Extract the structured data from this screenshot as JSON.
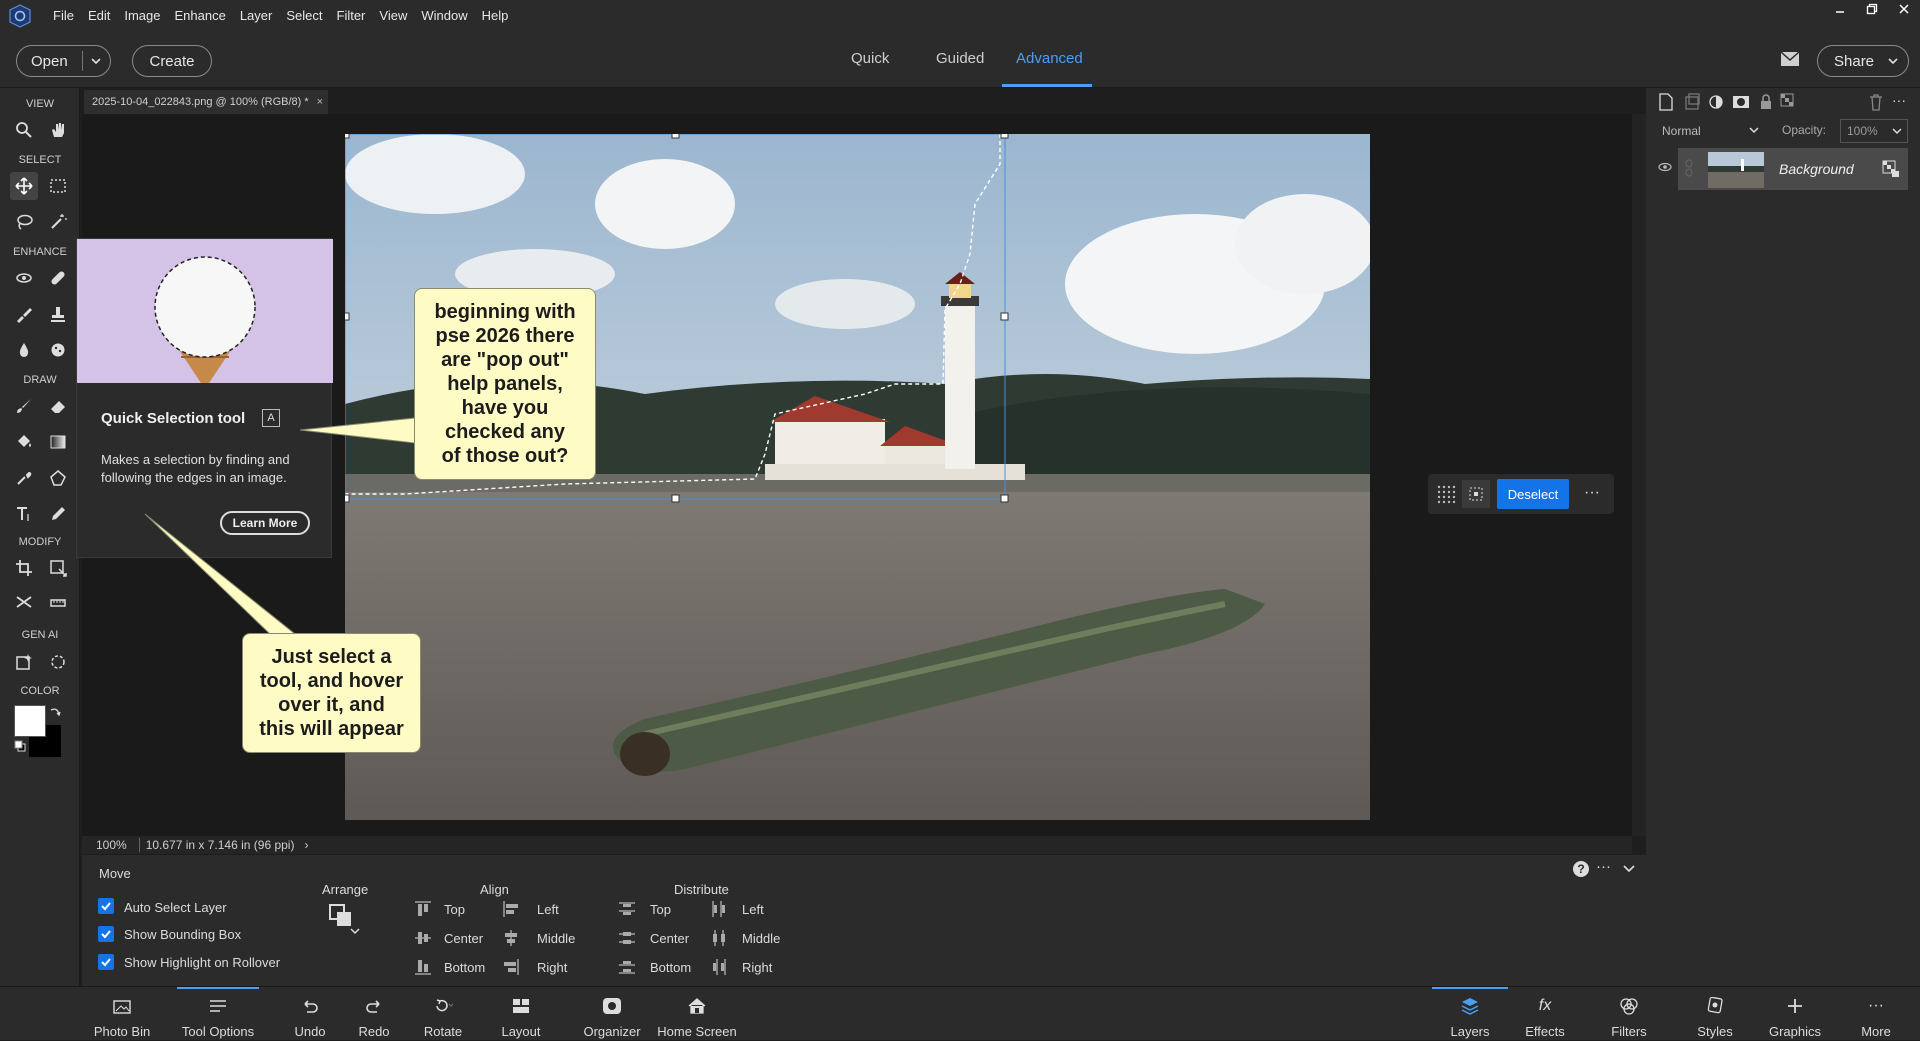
{
  "menubar": {
    "items": [
      "File",
      "Edit",
      "Image",
      "Enhance",
      "Layer",
      "Select",
      "Filter",
      "View",
      "Window",
      "Help"
    ]
  },
  "modebar": {
    "open_label": "Open",
    "create_label": "Create",
    "tabs": [
      "Quick",
      "Guided",
      "Advanced"
    ],
    "active_tab": "Advanced",
    "share_label": "Share"
  },
  "toolbox": {
    "sections": [
      "VIEW",
      "SELECT",
      "ENHANCE",
      "DRAW",
      "MODIFY",
      "GEN AI",
      "COLOR"
    ]
  },
  "document": {
    "tab_title": "2025-10-04_022843.png @ 100% (RGB/8) *",
    "close": "×"
  },
  "status": {
    "zoom": "100%",
    "dimensions": "10.677 in x 7.146 in (96 ppi)",
    "arrow": "›"
  },
  "context_bar": {
    "deselect_label": "Deselect",
    "more": "···"
  },
  "tooltip": {
    "title": "Quick Selection tool",
    "shortcut": "A",
    "description": "Makes a selection by finding and following the edges in an image.",
    "learn_more": "Learn More"
  },
  "callouts": {
    "top": [
      "beginning with",
      "pse 2026 there",
      "are \"pop out\"",
      "help panels,",
      "have you",
      "checked any",
      "of those out?"
    ],
    "bottom": [
      "Just select a",
      "tool, and hover",
      "over it, and",
      "this will appear"
    ]
  },
  "layers_panel": {
    "blend_mode": "Normal",
    "opacity_label": "Opacity:",
    "opacity_value": "100%",
    "layer_name": "Background"
  },
  "tool_options": {
    "tool_name": "Move",
    "checkboxes": [
      "Auto Select Layer",
      "Show Bounding Box",
      "Show Highlight on Rollover"
    ],
    "arrange_label": "Arrange",
    "align_label": "Align",
    "align_items": [
      "Top",
      "Left",
      "Center",
      "Middle",
      "Bottom",
      "Right"
    ],
    "distribute_label": "Distribute",
    "distribute_items": [
      "Top",
      "Left",
      "Center",
      "Middle",
      "Bottom",
      "Right"
    ]
  },
  "taskbar": {
    "left": [
      "Photo Bin",
      "Tool Options",
      "Undo",
      "Redo",
      "Rotate",
      "Layout",
      "Organizer",
      "Home Screen"
    ],
    "right": [
      "Layers",
      "Effects",
      "Filters",
      "Styles",
      "Graphics",
      "More"
    ],
    "selected_left": "Tool Options",
    "selected_right": "Layers"
  },
  "colors": {
    "accent": "#4c9ff5",
    "button_blue": "#1473e6",
    "callout_bg": "#fefcc4"
  }
}
